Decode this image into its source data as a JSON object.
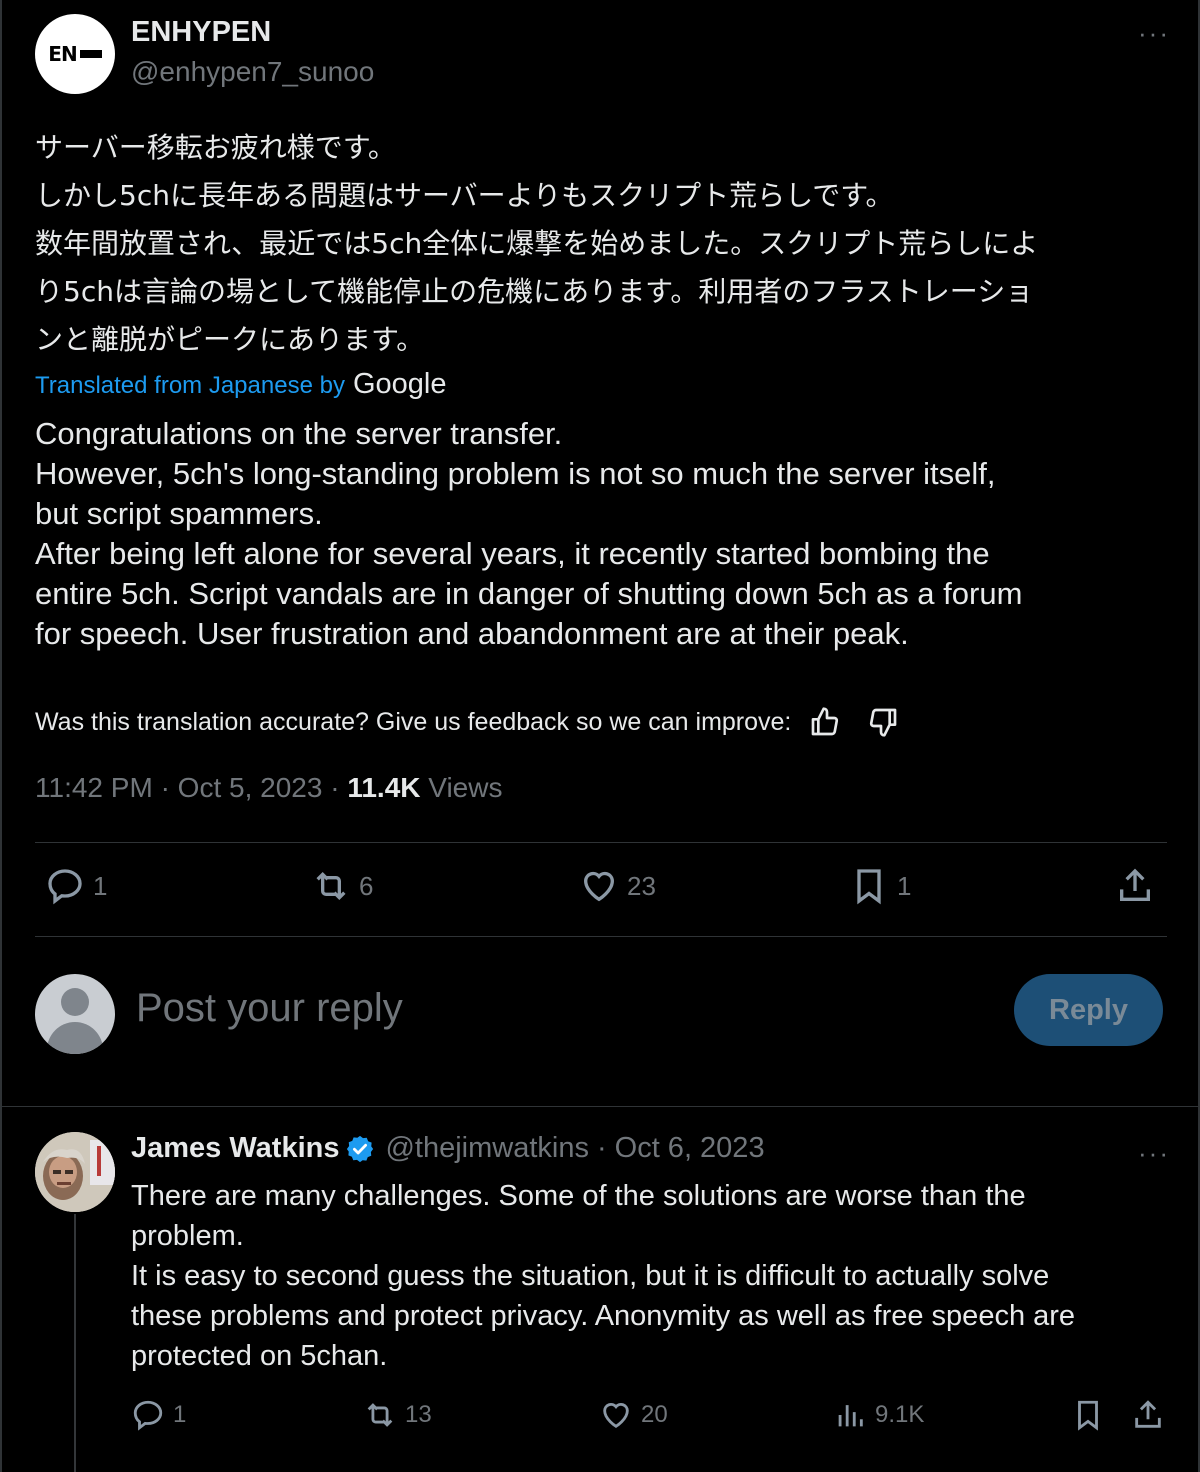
{
  "main_tweet": {
    "avatar_text": "EN",
    "author_name": "ENHYPEN",
    "author_handle": "@enhypen7_sunoo",
    "more_label": "···",
    "original_lines": [
      "サーバー移転お疲れ様です。",
      "しかし5chに長年ある問題はサーバーよりもスクリプト荒らしです。",
      "数年間放置され、最近では5ch全体に爆撃を始めました。スクリプト荒らしによ",
      "り5chは言論の場として機能停止の危機にあります。利用者のフラストレーショ",
      "ンと離脱がピークにあります。"
    ],
    "translated_label": "Translated from Japanese by",
    "translator": "Google",
    "translation_lines": [
      "Congratulations on the server transfer.",
      "However, 5ch's long-standing problem is not so much the server itself,",
      "but script spammers.",
      "After being left alone for several years, it recently started bombing the",
      "entire 5ch. Script vandals are in danger of shutting down 5ch as a forum",
      "for speech. User frustration and abandonment are at their peak."
    ],
    "feedback_text": "Was this translation accurate? Give us feedback so we can improve:",
    "time": "11:42 PM",
    "date": "Oct 5, 2023",
    "views_count": "11.4K",
    "views_label": "Views",
    "replies": "1",
    "reposts": "6",
    "likes": "23",
    "bookmarks": "1"
  },
  "composer": {
    "placeholder": "Post your reply",
    "button_label": "Reply"
  },
  "reply_tweet": {
    "author_name": "James Watkins",
    "author_handle": "@thejimwatkins",
    "date": "Oct 6, 2023",
    "more_label": "···",
    "lines": [
      "There are many challenges. Some of the solutions are worse than the",
      "problem.",
      "It is easy to second guess the situation, but it is difficult to actually solve",
      "these problems and protect privacy. Anonymity as well as free speech are",
      "protected on 5chan."
    ],
    "replies": "1",
    "reposts": "13",
    "likes": "20",
    "views": "9.1K"
  },
  "colors": {
    "background": "#000000",
    "text": "#e7e9ea",
    "muted": "#71767b",
    "link": "#1d9bf0",
    "reply_button": "#1d4f76",
    "verified": "#1d9bf0"
  }
}
